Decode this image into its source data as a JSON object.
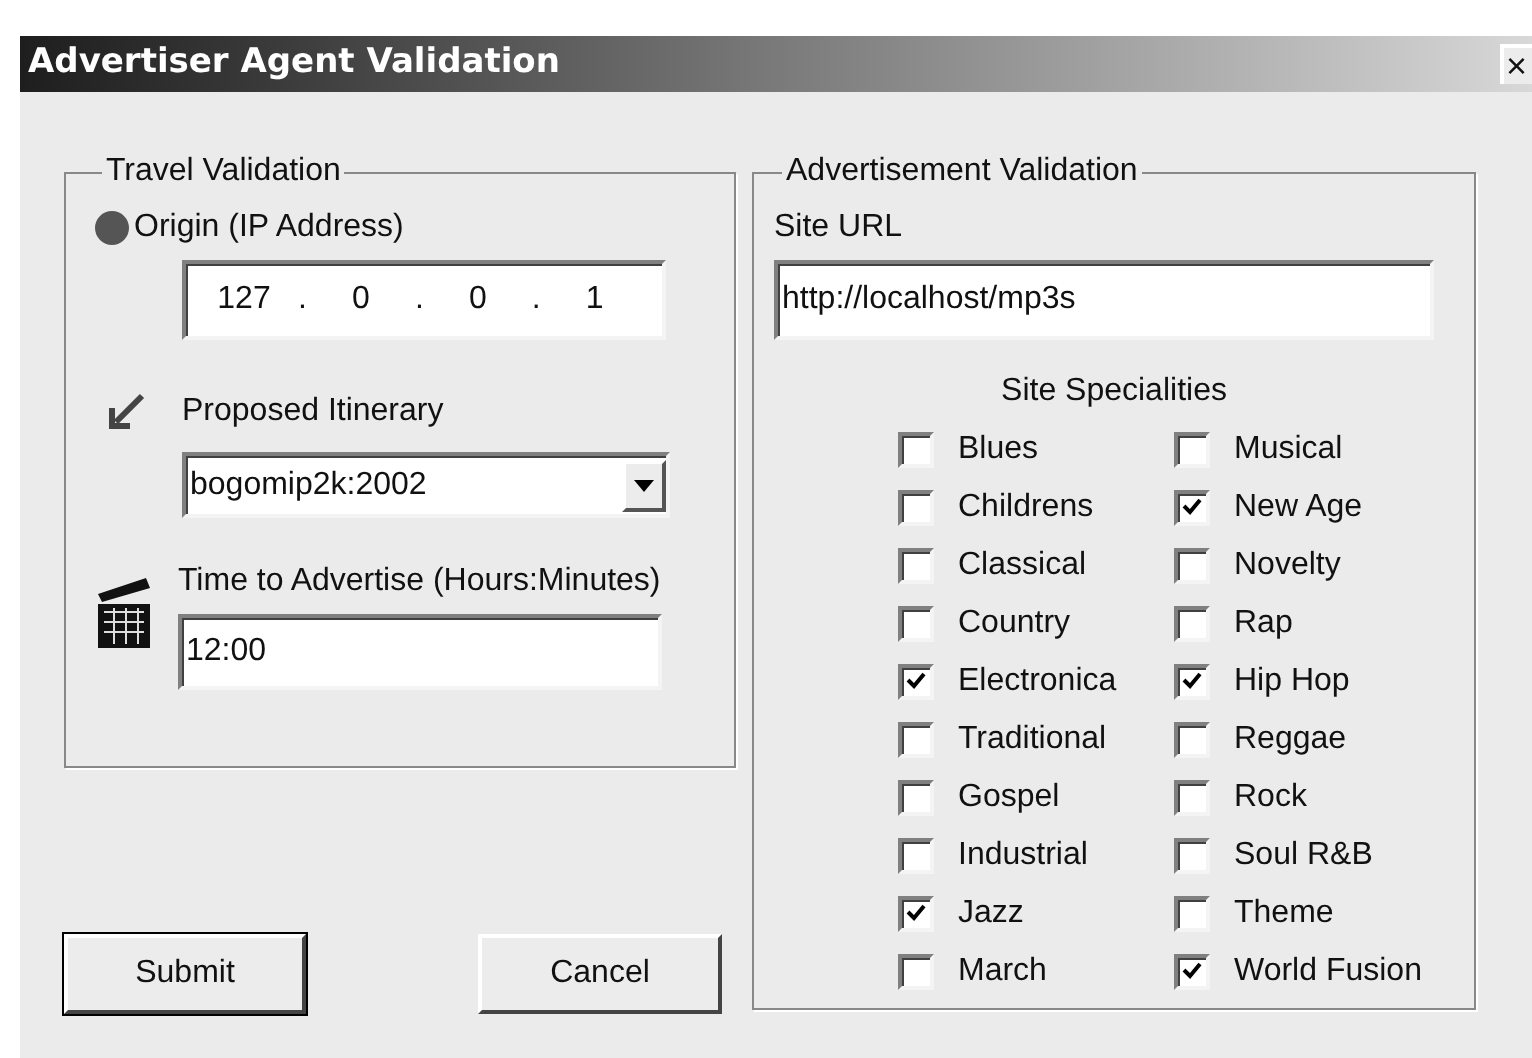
{
  "window": {
    "title": "Advertiser Agent Validation",
    "close": "×"
  },
  "travel": {
    "legend": "Travel Validation",
    "origin": {
      "label": "Origin (IP Address)",
      "octets": [
        "127",
        "0",
        "0",
        "1"
      ],
      "separator": "."
    },
    "itinerary": {
      "label": "Proposed Itinerary",
      "value": "bogomip2k:2002"
    },
    "time": {
      "label": "Time to Advertise (Hours:Minutes)",
      "value": "12:00"
    }
  },
  "buttons": [
    {
      "label": "Submit",
      "selected": true
    },
    {
      "label": "Cancel",
      "selected": false
    }
  ],
  "advertisement": {
    "legend": "Advertisement Validation",
    "url_label": "Site URL",
    "url": "http://localhost/mp3s",
    "specialities_label": "Site Specialities",
    "specialities": [
      {
        "label": "Blues",
        "checked": false
      },
      {
        "label": "Musical",
        "checked": false
      },
      {
        "label": "Childrens",
        "checked": false
      },
      {
        "label": "New Age",
        "checked": true
      },
      {
        "label": "Classical",
        "checked": false
      },
      {
        "label": "Novelty",
        "checked": false
      },
      {
        "label": "Country",
        "checked": false
      },
      {
        "label": "Rap",
        "checked": false
      },
      {
        "label": "Electronica",
        "checked": true
      },
      {
        "label": "Hip Hop",
        "checked": true
      },
      {
        "label": "Traditional",
        "checked": false
      },
      {
        "label": "Reggae",
        "checked": false
      },
      {
        "label": "Gospel",
        "checked": false
      },
      {
        "label": "Rock",
        "checked": false
      },
      {
        "label": "Industrial",
        "checked": false
      },
      {
        "label": "Soul R&B",
        "checked": false
      },
      {
        "label": "Jazz",
        "checked": true
      },
      {
        "label": "Theme",
        "checked": false
      },
      {
        "label": "March",
        "checked": false
      },
      {
        "label": "World Fusion",
        "checked": true
      }
    ]
  }
}
